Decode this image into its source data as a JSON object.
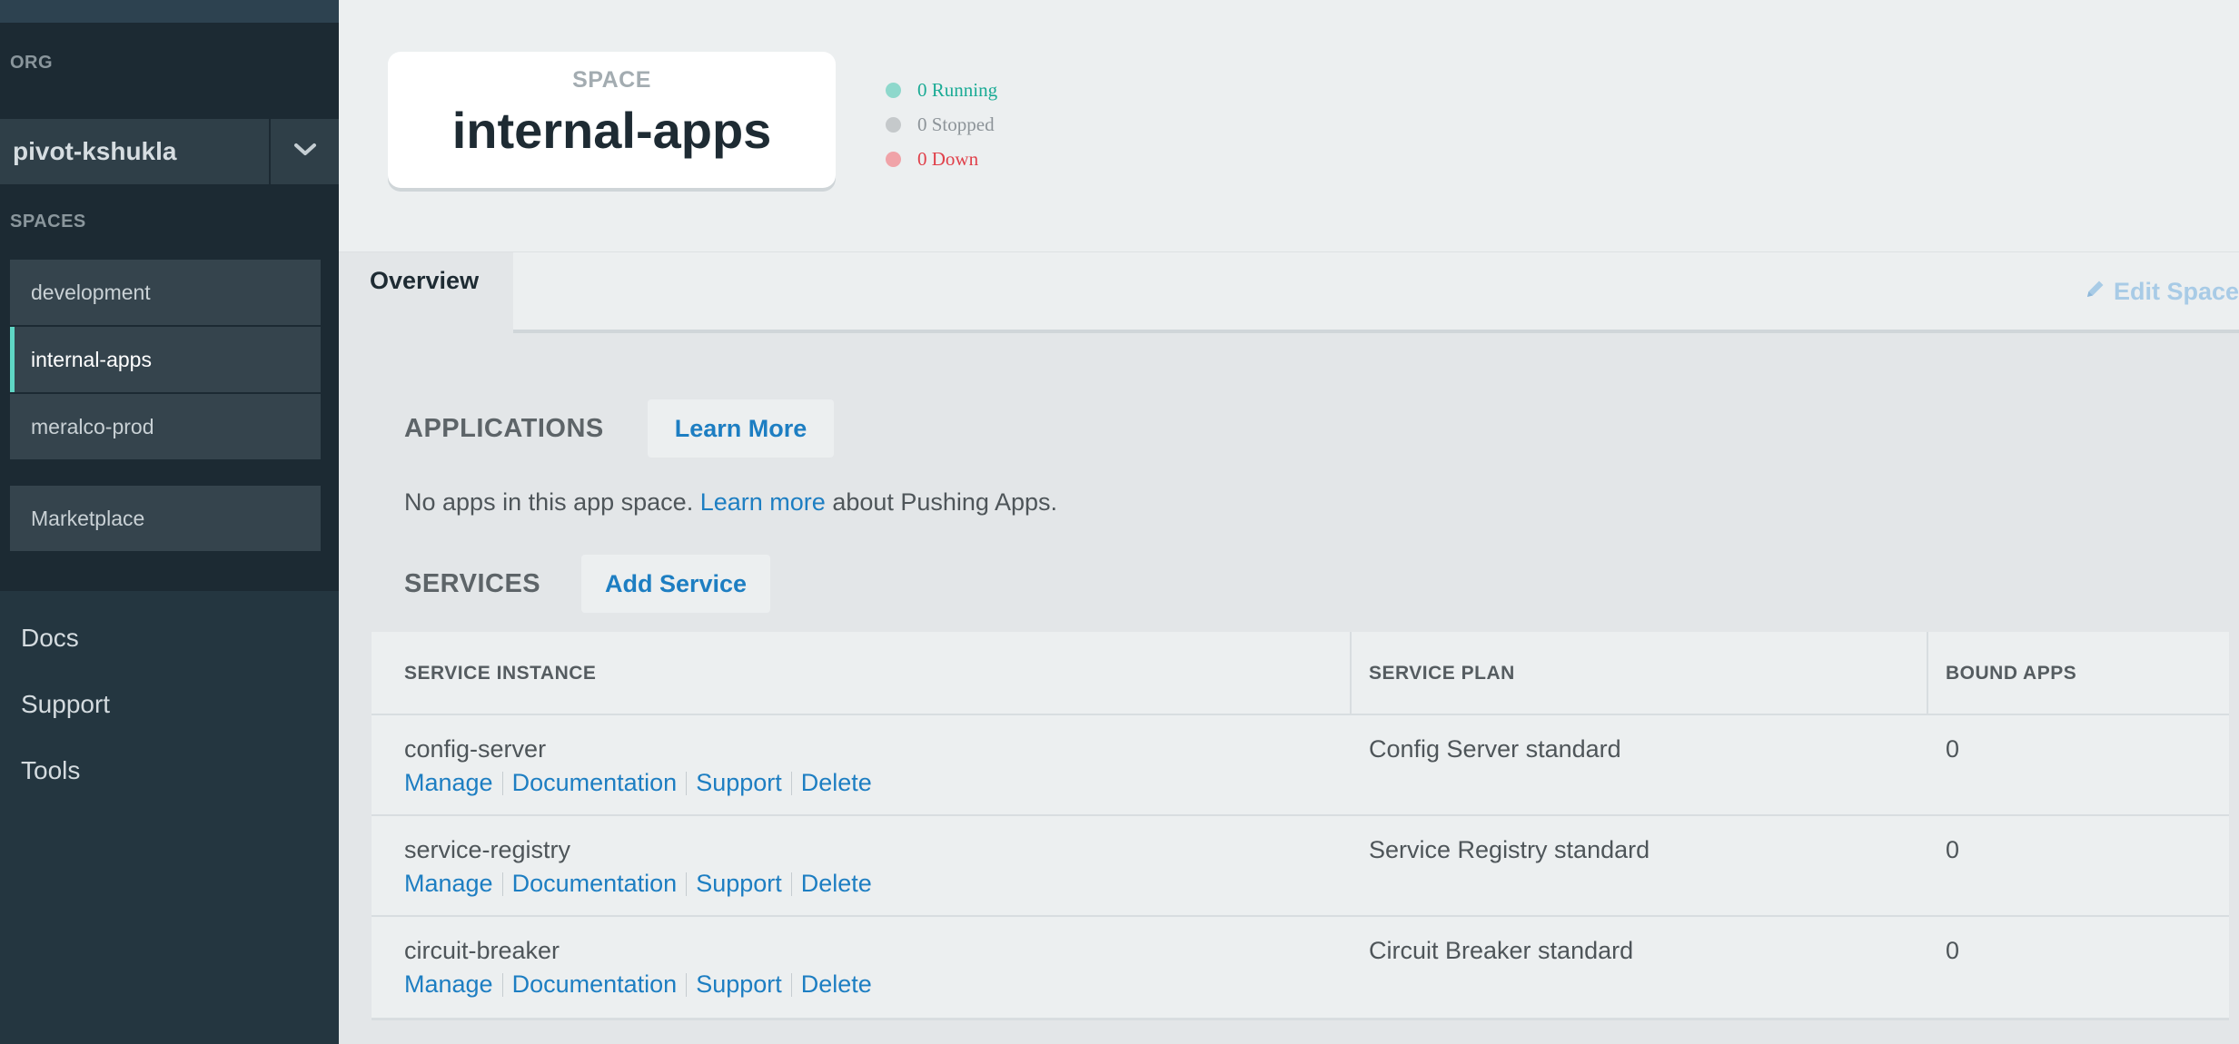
{
  "sidebar": {
    "org_heading": "ORG",
    "org_name": "pivot-kshukla",
    "spaces_heading": "SPACES",
    "spaces": [
      {
        "label": "development",
        "active": false
      },
      {
        "label": "internal-apps",
        "active": true
      },
      {
        "label": "meralco-prod",
        "active": false
      }
    ],
    "marketplace_label": "Marketplace",
    "links": [
      "Docs",
      "Support",
      "Tools"
    ]
  },
  "header": {
    "space_label": "SPACE",
    "space_name": "internal-apps",
    "status": [
      {
        "label": "0 Running",
        "color": "#1bab95",
        "dot_color": "#8ed8cc"
      },
      {
        "label": "0 Stopped",
        "color": "#8d9499",
        "dot_color": "#c5c9cb"
      },
      {
        "label": "0 Down",
        "color": "#e0404a",
        "dot_color": "#f0a3a8"
      }
    ]
  },
  "tabs": {
    "overview_label": "Overview",
    "edit_space_label": "Edit Space"
  },
  "applications": {
    "title": "APPLICATIONS",
    "learn_more_button": "Learn More",
    "message_prefix": "No apps in this app space.",
    "message_link": "Learn more",
    "message_suffix": "about Pushing Apps."
  },
  "services": {
    "title": "SERVICES",
    "add_button": "Add Service",
    "columns": [
      "SERVICE INSTANCE",
      "SERVICE PLAN",
      "BOUND APPS"
    ],
    "action_labels": [
      "Manage",
      "Documentation",
      "Support",
      "Delete"
    ],
    "rows": [
      {
        "instance": "config-server",
        "plan": "Config Server standard",
        "bound_apps": "0"
      },
      {
        "instance": "service-registry",
        "plan": "Service Registry standard",
        "bound_apps": "0"
      },
      {
        "instance": "circuit-breaker",
        "plan": "Circuit Breaker standard",
        "bound_apps": "0"
      }
    ]
  },
  "colors": {
    "accent": "#5fd6c4",
    "link": "#1d7ec2",
    "sidebar_bg": "#243640"
  }
}
